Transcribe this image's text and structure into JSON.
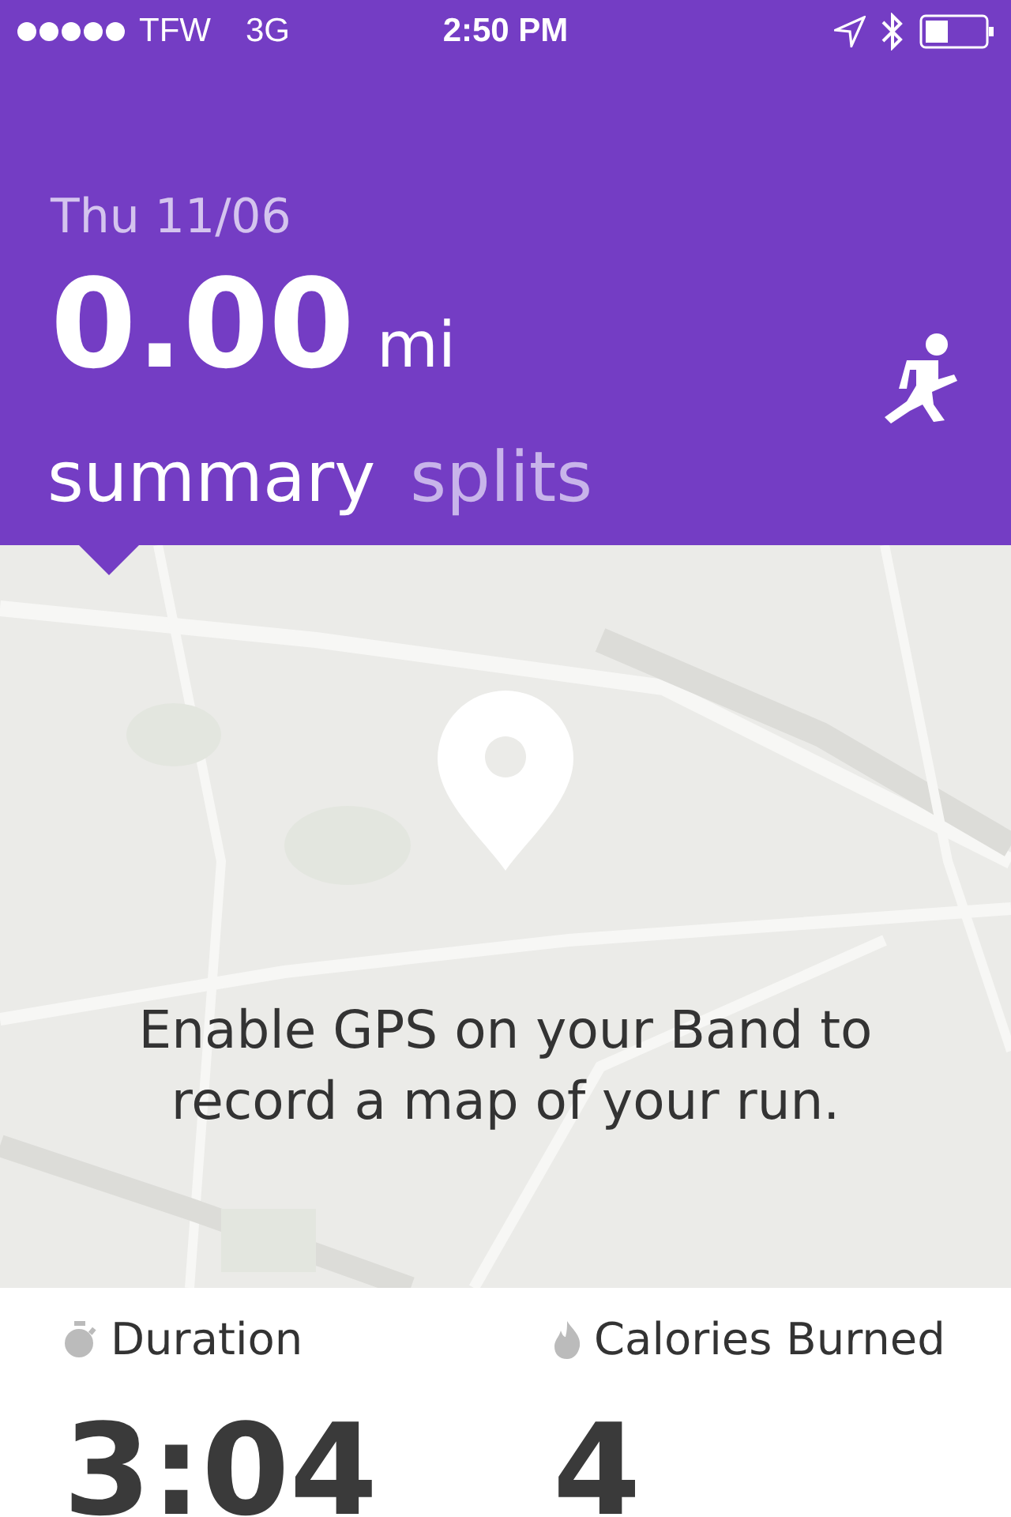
{
  "status_bar": {
    "carrier": "TFW",
    "network": "3G",
    "time": "2:50 PM"
  },
  "header": {
    "date": "Thu 11/06",
    "distance": "0.00",
    "unit": "mi"
  },
  "tabs": [
    {
      "label": "summary",
      "selected": true
    },
    {
      "label": "splits",
      "selected": false
    }
  ],
  "map": {
    "kind": "picture",
    "message": "Enable GPS on your Band to record a map of your run."
  },
  "stats": [
    {
      "kind": "duration",
      "label": "Duration",
      "value": "3:04"
    },
    {
      "kind": "calories",
      "label": "Calories Burned",
      "value": "4"
    }
  ]
}
